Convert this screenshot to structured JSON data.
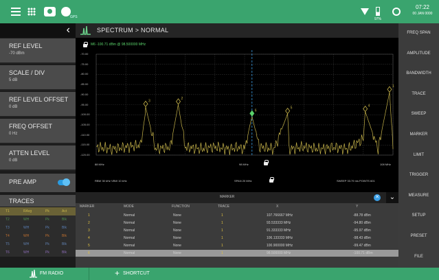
{
  "status_bar": {
    "gps_sub": "GPS",
    "battery_pct": "97%",
    "time": "07:22",
    "date": "00 JAN 0000"
  },
  "left_panel": {
    "params": [
      {
        "label": "REF LEVEL",
        "value": "-70 dBm"
      },
      {
        "label": "SCALE / DIV",
        "value": "5 dB"
      },
      {
        "label": "REF LEVEL OFFSET",
        "value": "0 dB"
      },
      {
        "label": "FREQ OFFSET",
        "value": "0 Hz"
      },
      {
        "label": "ATTEN LEVEL",
        "value": "0 dB"
      }
    ],
    "preamp_label": "PRE AMP",
    "preamp_on": true,
    "traces_label": "TRACES",
    "traces": [
      {
        "name": "T1",
        "mode": "RAvg",
        "det": "Pk",
        "state": "Act"
      },
      {
        "name": "T2",
        "mode": "WH",
        "det": "Pk",
        "state": "Blk"
      },
      {
        "name": "T3",
        "mode": "WH",
        "det": "Pk",
        "state": "Blk"
      },
      {
        "name": "T4",
        "mode": "WH",
        "det": "Pk",
        "state": "Blk"
      },
      {
        "name": "T5",
        "mode": "WH",
        "det": "Pk",
        "state": "Blk"
      },
      {
        "name": "T6",
        "mode": "WH",
        "det": "Pk",
        "state": "Blk"
      }
    ]
  },
  "header": {
    "title": "SPECTRUM  >  NORMAL"
  },
  "plot": {
    "marker_readout": "M6  -100.71 dBm @ 98.500000 MHz",
    "y_ticks": [
      "-70.00",
      "-75.00",
      "-80.00",
      "-85.00",
      "-90.00",
      "-95.00",
      "-100.00",
      "-105.00",
      "-110.00",
      "-115.00",
      "-120.00"
    ],
    "x_start": "88 MHz",
    "x_center": "98 MHz",
    "x_stop": "108 MHz",
    "rbw_vbw": "RBW 30 kHz   VBW 10 kHz",
    "span": "SPAN 20 MHz",
    "sweep": "SWEEP  33.79 ms   POINTS 601"
  },
  "chart_data": {
    "type": "line",
    "x": [
      88,
      89,
      90,
      91,
      91.3,
      91.33,
      92,
      93,
      93.53,
      94,
      95,
      96,
      97,
      97.5,
      98,
      98.5,
      99,
      100,
      100.9,
      101,
      102,
      103,
      104,
      105,
      106,
      106.13,
      107,
      107.77,
      108
    ],
    "values": [
      -116,
      -117,
      -116,
      -115,
      -100,
      -96,
      -117,
      -116,
      -95,
      -116,
      -117,
      -116,
      -117,
      -116,
      -117,
      -100.7,
      -116,
      -117,
      -99.5,
      -117,
      -116,
      -117,
      -116,
      -117,
      -112,
      -98.4,
      -117,
      -88.8,
      -117
    ],
    "xlim": [
      88,
      108
    ],
    "ylim": [
      -120,
      -70
    ],
    "grid": true,
    "markers": [
      {
        "id": "1",
        "x": 107.766667,
        "y": -88.78
      },
      {
        "id": "2",
        "x": 93.533333,
        "y": -94.8
      },
      {
        "id": "3",
        "x": 91.333333,
        "y": -95.97
      },
      {
        "id": "4",
        "x": 106.133333,
        "y": -98.43
      },
      {
        "id": "5",
        "x": 100.9,
        "y": -99.47
      },
      {
        "id": "6",
        "x": 98.5,
        "y": -100.71
      }
    ],
    "colors": {
      "trace": "#c8b54a",
      "marker": "#5bd36b",
      "active_marker_line": "#3aa0e8"
    }
  },
  "marker_table": {
    "title": "MARKER",
    "columns": [
      "MARKER",
      "MODE",
      "FUNCTION",
      "TRACE",
      "X",
      "Y"
    ],
    "rows": [
      {
        "marker": "1",
        "mode": "Normal",
        "function": "None",
        "trace": "1",
        "x": "107.766667 MHz",
        "y": "-88.78 dBm"
      },
      {
        "marker": "2",
        "mode": "Normal",
        "function": "None",
        "trace": "1",
        "x": "93.533333 MHz",
        "y": "-94.80 dBm"
      },
      {
        "marker": "3",
        "mode": "Normal",
        "function": "None",
        "trace": "1",
        "x": "91.333333 MHz",
        "y": "-95.97 dBm"
      },
      {
        "marker": "4",
        "mode": "Normal",
        "function": "None",
        "trace": "1",
        "x": "106.133333 MHz",
        "y": "-98.43 dBm"
      },
      {
        "marker": "5",
        "mode": "Normal",
        "function": "None",
        "trace": "1",
        "x": "100.900000 MHz",
        "y": "-99.47 dBm"
      },
      {
        "marker": "6",
        "mode": "Normal",
        "function": "None",
        "trace": "1",
        "x": "98.500000 MHz",
        "y": "-100.71 dBm"
      }
    ]
  },
  "right_menu": [
    "FREQ SPAN",
    "AMPLITUDE",
    "BANDWIDTH",
    "TRACE",
    "SWEEP",
    "MARKER",
    "LIMIT",
    "TRIGGER",
    "MEASURE",
    "SETUP",
    "PRESET",
    "FILE"
  ],
  "bottom_bar": {
    "mode_label": "FM RADIO",
    "shortcut_label": "SHORTCUT"
  }
}
